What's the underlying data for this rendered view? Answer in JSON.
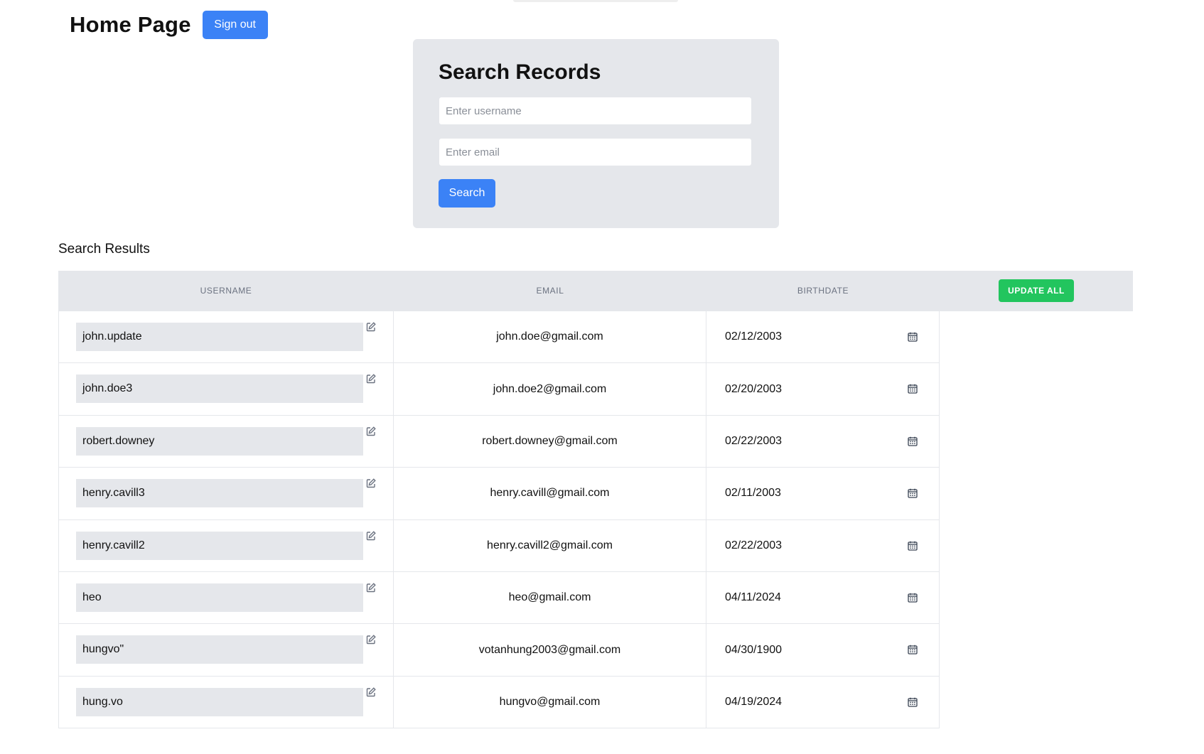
{
  "header": {
    "title": "Home Page",
    "signout_label": "Sign out"
  },
  "search": {
    "title": "Search Records",
    "username_placeholder": "Enter username",
    "email_placeholder": "Enter email",
    "username_value": "",
    "email_value": "",
    "button_label": "Search"
  },
  "results": {
    "title": "Search Results",
    "columns": {
      "username": "USERNAME",
      "email": "EMAIL",
      "birthdate": "BIRTHDATE"
    },
    "update_all_label": "UPDATE ALL",
    "rows": [
      {
        "username": "john.update",
        "email": "john.doe@gmail.com",
        "birthdate": "02/12/2003"
      },
      {
        "username": "john.doe3",
        "email": "john.doe2@gmail.com",
        "birthdate": "02/20/2003"
      },
      {
        "username": "robert.downey",
        "email": "robert.downey@gmail.com",
        "birthdate": "02/22/2003"
      },
      {
        "username": "henry.cavill3",
        "email": "henry.cavill@gmail.com",
        "birthdate": "02/11/2003"
      },
      {
        "username": "henry.cavill2",
        "email": "henry.cavill2@gmail.com",
        "birthdate": "02/22/2003"
      },
      {
        "username": "heo",
        "email": "heo@gmail.com",
        "birthdate": "04/11/2024"
      },
      {
        "username": "hungvo\"",
        "email": "votanhung2003@gmail.com",
        "birthdate": "04/30/1900"
      },
      {
        "username": "hung.vo",
        "email": "hungvo@gmail.com",
        "birthdate": "04/19/2024"
      }
    ]
  },
  "icons": {
    "edit": "edit-icon",
    "calendar": "calendar-icon"
  },
  "colors": {
    "primary": "#3b82f6",
    "success": "#22c55e",
    "panel": "#e5e7eb"
  }
}
